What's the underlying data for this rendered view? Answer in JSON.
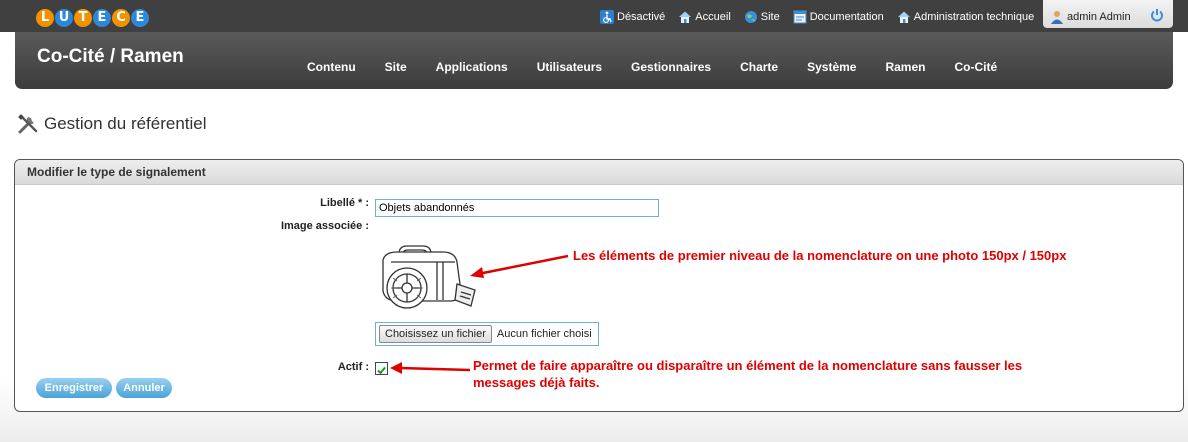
{
  "header": {
    "logo_letters": [
      {
        "char": "L",
        "color": "#f29200"
      },
      {
        "char": "U",
        "color": "#2c88d9"
      },
      {
        "char": "T",
        "color": "#f29200"
      },
      {
        "char": "E",
        "color": "#2c88d9"
      },
      {
        "char": "C",
        "color": "#f29200"
      },
      {
        "char": "E",
        "color": "#2c88d9"
      }
    ],
    "top_links": [
      {
        "label": "Désactivé",
        "icon": "accessibility-icon"
      },
      {
        "label": "Accueil",
        "icon": "home-icon"
      },
      {
        "label": "Site",
        "icon": "globe-icon"
      },
      {
        "label": "Documentation",
        "icon": "documentation-icon"
      },
      {
        "label": "Administration technique",
        "icon": "home-icon"
      }
    ],
    "user": {
      "name": "admin Admin",
      "icon": "user-icon",
      "logout_icon": "power-icon"
    },
    "site_title": "Co-Cité / Ramen",
    "menu": [
      "Contenu",
      "Site",
      "Applications",
      "Utilisateurs",
      "Gestionnaires",
      "Charte",
      "Système",
      "Ramen",
      "Co-Cité"
    ]
  },
  "page": {
    "title": "Gestion du référentiel",
    "title_icon": "tools-icon"
  },
  "form": {
    "panel_title": "Modifier le type de signalement",
    "label_libelle": "Libellé * :",
    "libelle_value": "Objets abandonnés",
    "label_image": "Image associée :",
    "image_icon": "abandoned-luggage-illustration",
    "file_button": "Choisissez un fichier",
    "file_status": "Aucun fichier choisi",
    "label_actif": "Actif :",
    "actif_checked": true,
    "save_button": "Enregistrer",
    "cancel_button": "Annuler"
  },
  "annotations": {
    "image_note": "Les éléments de premier niveau de la nomenclature on une photo 150px / 150px",
    "actif_note_line1": "Permet de faire apparaître ou disparaître un élément de la nomenclature sans fausser les",
    "actif_note_line2": "messages déjà faits.",
    "color": "#e00000"
  }
}
